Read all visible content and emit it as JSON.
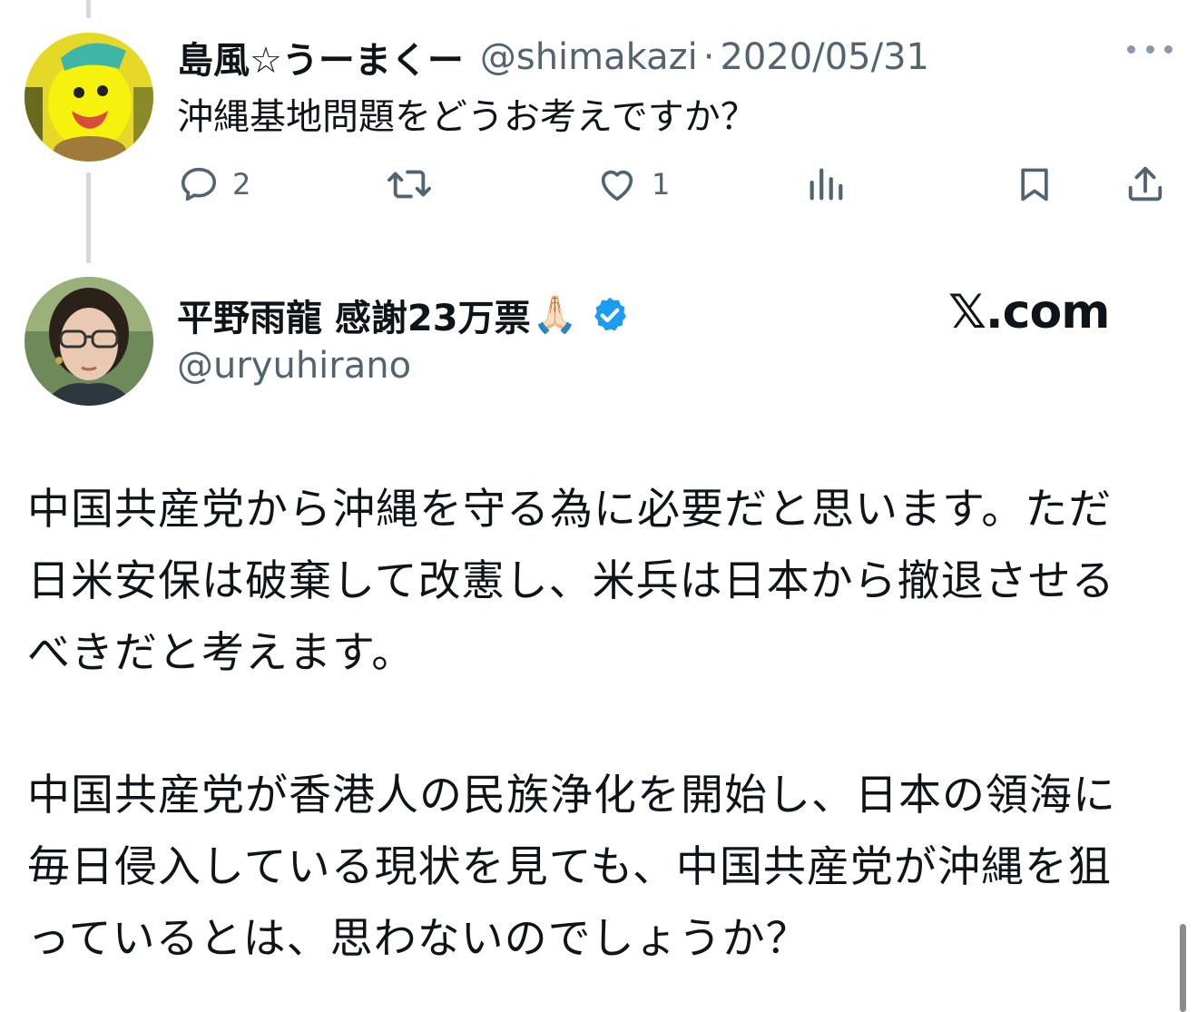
{
  "reply_tweet": {
    "display_name": "島風☆うーまくー",
    "handle": "@shimakazi",
    "separator": "·",
    "date": "2020/05/31",
    "text": "沖縄基地問題をどうお考えですか？",
    "actions": {
      "reply_count": "2",
      "retweet_count": "",
      "like_count": "1"
    },
    "icons": [
      "reply-icon",
      "retweet-icon",
      "like-icon",
      "views-icon",
      "bookmark-icon",
      "share-icon",
      "more-icon"
    ]
  },
  "main_tweet": {
    "display_name": "平野雨龍 感謝23万票",
    "emoji": "🙏🏻",
    "handle": "@uryuhirano",
    "verified_color": "#1d9bf0",
    "paragraph1": [
      "中国共産党から沖縄を守る為に必要だと思います。ただ",
      "日米安保は破棄して改憲し、米兵は日本から撤退させる",
      "べきだと考えます。"
    ],
    "paragraph2": [
      "中国共産党が香港人の民族浄化を開始し、日本の領海に",
      "毎日侵入している現状を見ても、中国共産党が沖縄を狙",
      "っているとは、思わないのでしょうか？"
    ]
  },
  "watermark": "𝕏.com",
  "colors": {
    "text": "#0f1419",
    "secondary": "#536471",
    "accent": "#1d9bf0",
    "thread_line": "#cfd9de"
  }
}
